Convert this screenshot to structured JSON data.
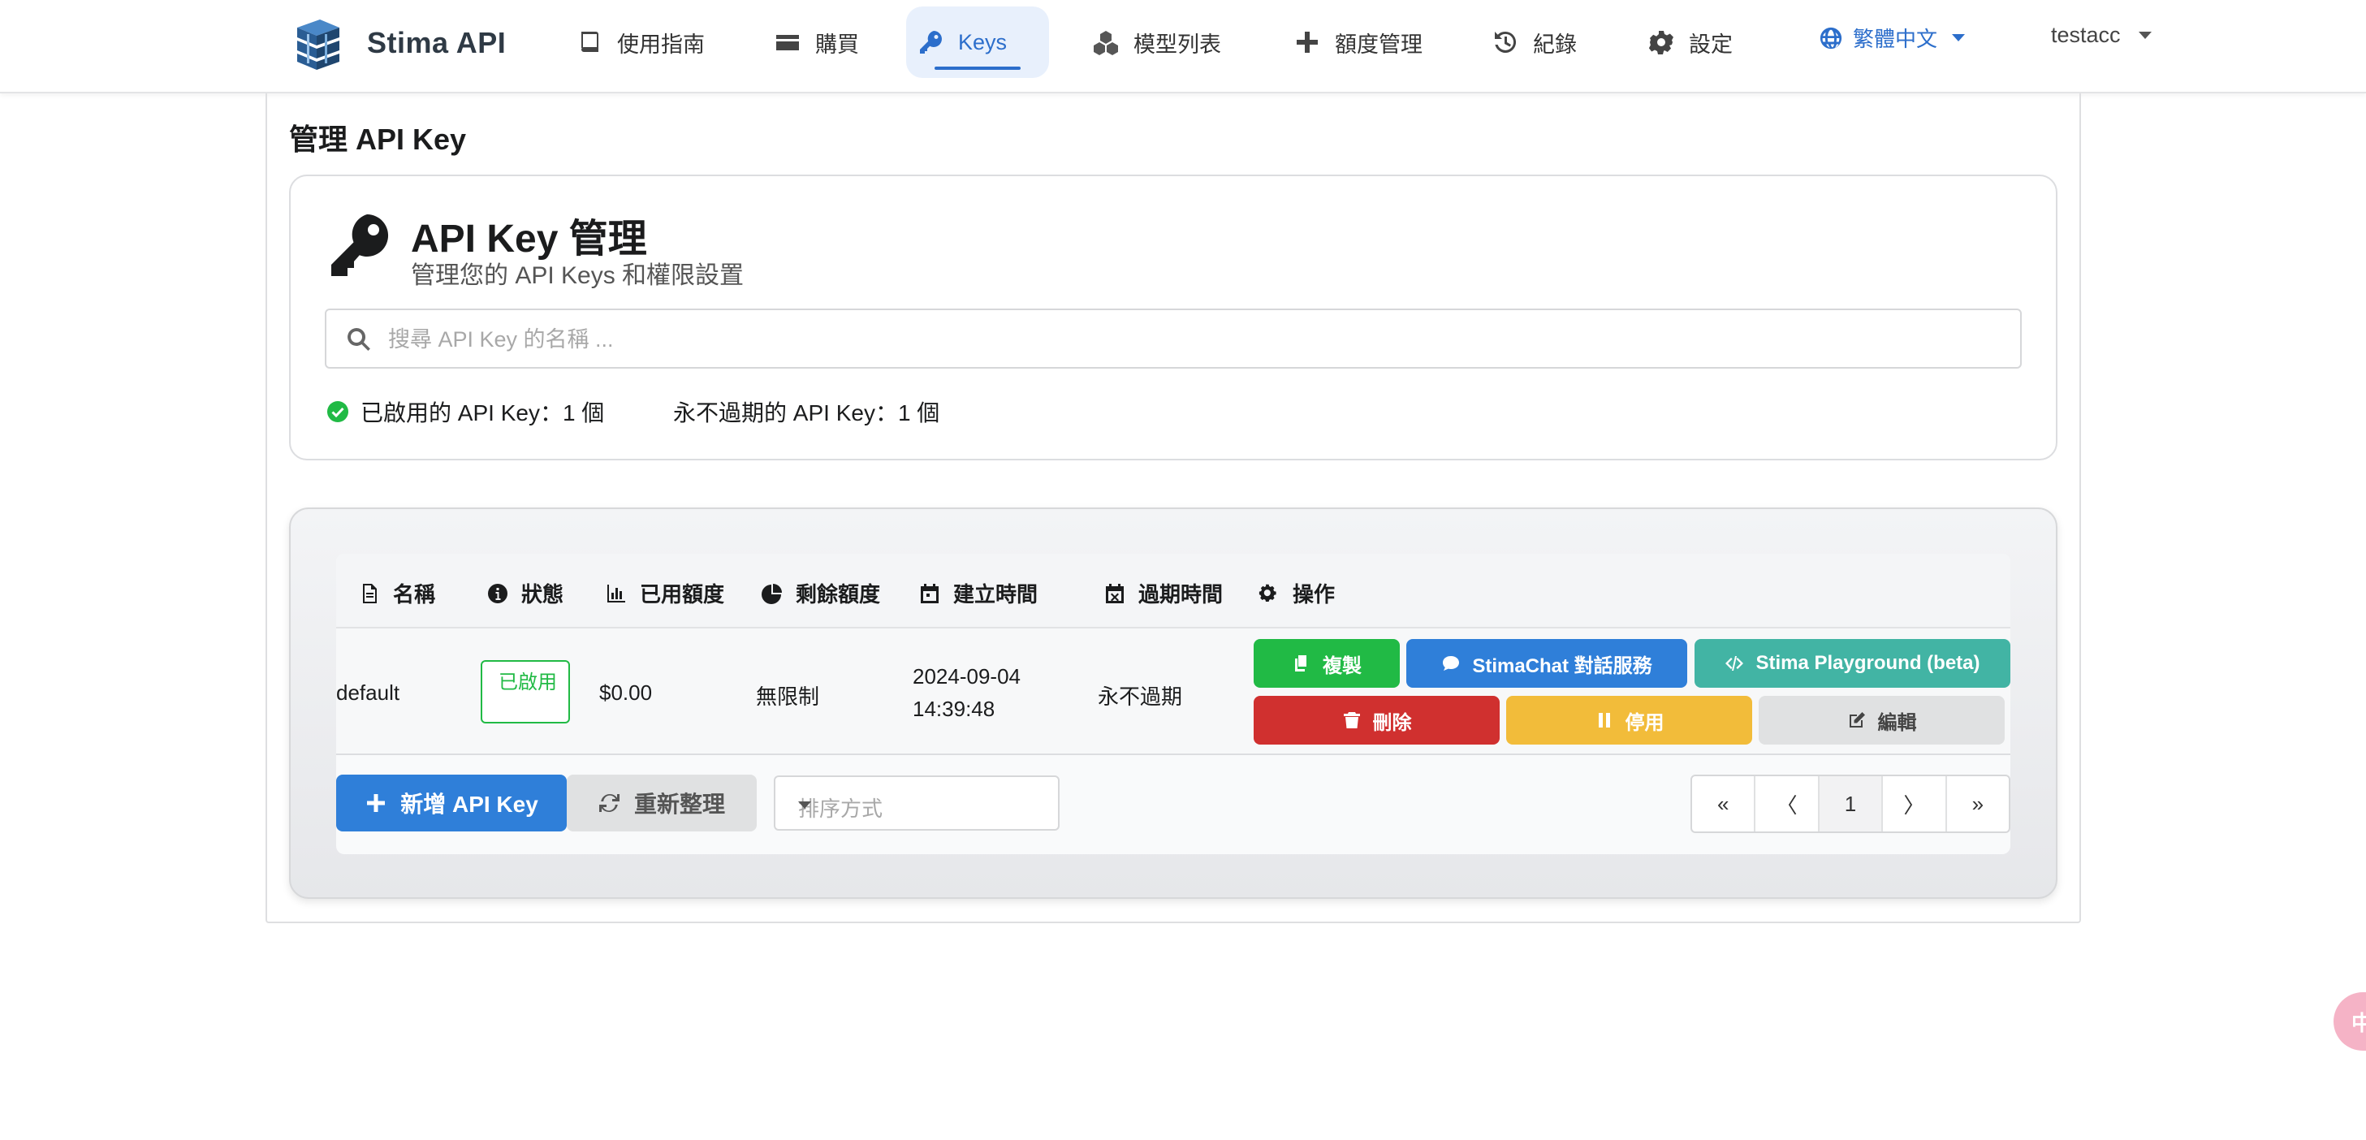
{
  "brand": {
    "name": "Stima API"
  },
  "nav": {
    "items": [
      {
        "label": "使用指南",
        "icon": "book-icon"
      },
      {
        "label": "購買",
        "icon": "credit-card-icon"
      },
      {
        "label": "Keys",
        "icon": "key-icon",
        "active": true
      },
      {
        "label": "模型列表",
        "icon": "cubes-icon"
      },
      {
        "label": "額度管理",
        "icon": "plus-icon"
      },
      {
        "label": "紀錄",
        "icon": "history-icon"
      },
      {
        "label": "設定",
        "icon": "gear-icon"
      }
    ],
    "language": "繁體中文",
    "user": "testacc"
  },
  "page": {
    "title": "管理 API Key"
  },
  "header": {
    "title": "API Key 管理",
    "subtitle": "管理您的 API Keys 和權限設置",
    "search_placeholder": "搜尋 API Key 的名稱 ...",
    "stat_enabled": "已啟用的 API Key：1 個",
    "stat_never_expire": "永不過期的 API Key：1 個"
  },
  "table": {
    "headers": [
      "名稱",
      "狀態",
      "已用額度",
      "剩餘額度",
      "建立時間",
      "過期時間",
      "操作"
    ],
    "rows": [
      {
        "name": "default",
        "status": "已啟用",
        "used": "$0.00",
        "remaining": "無限制",
        "created_date": "2024-09-04",
        "created_time": "14:39:48",
        "expires": "永不過期"
      }
    ],
    "actions": {
      "copy": "複製",
      "chat": "StimaChat 對話服務",
      "playground": "Stima Playground (beta)",
      "delete": "刪除",
      "disable": "停用",
      "edit": "編輯"
    }
  },
  "footer": {
    "add": "新增 API Key",
    "refresh": "重新整理",
    "sort_placeholder": "排序方式",
    "pager": [
      "«",
      "〈",
      "1",
      "〉",
      "»"
    ]
  },
  "float_button": {
    "glyph": "中"
  },
  "colors": {
    "accent": "#2c6ecb",
    "success": "#21ba45",
    "danger": "#d0302f",
    "warning": "#f2bc3a",
    "teal": "#42b4a4"
  }
}
